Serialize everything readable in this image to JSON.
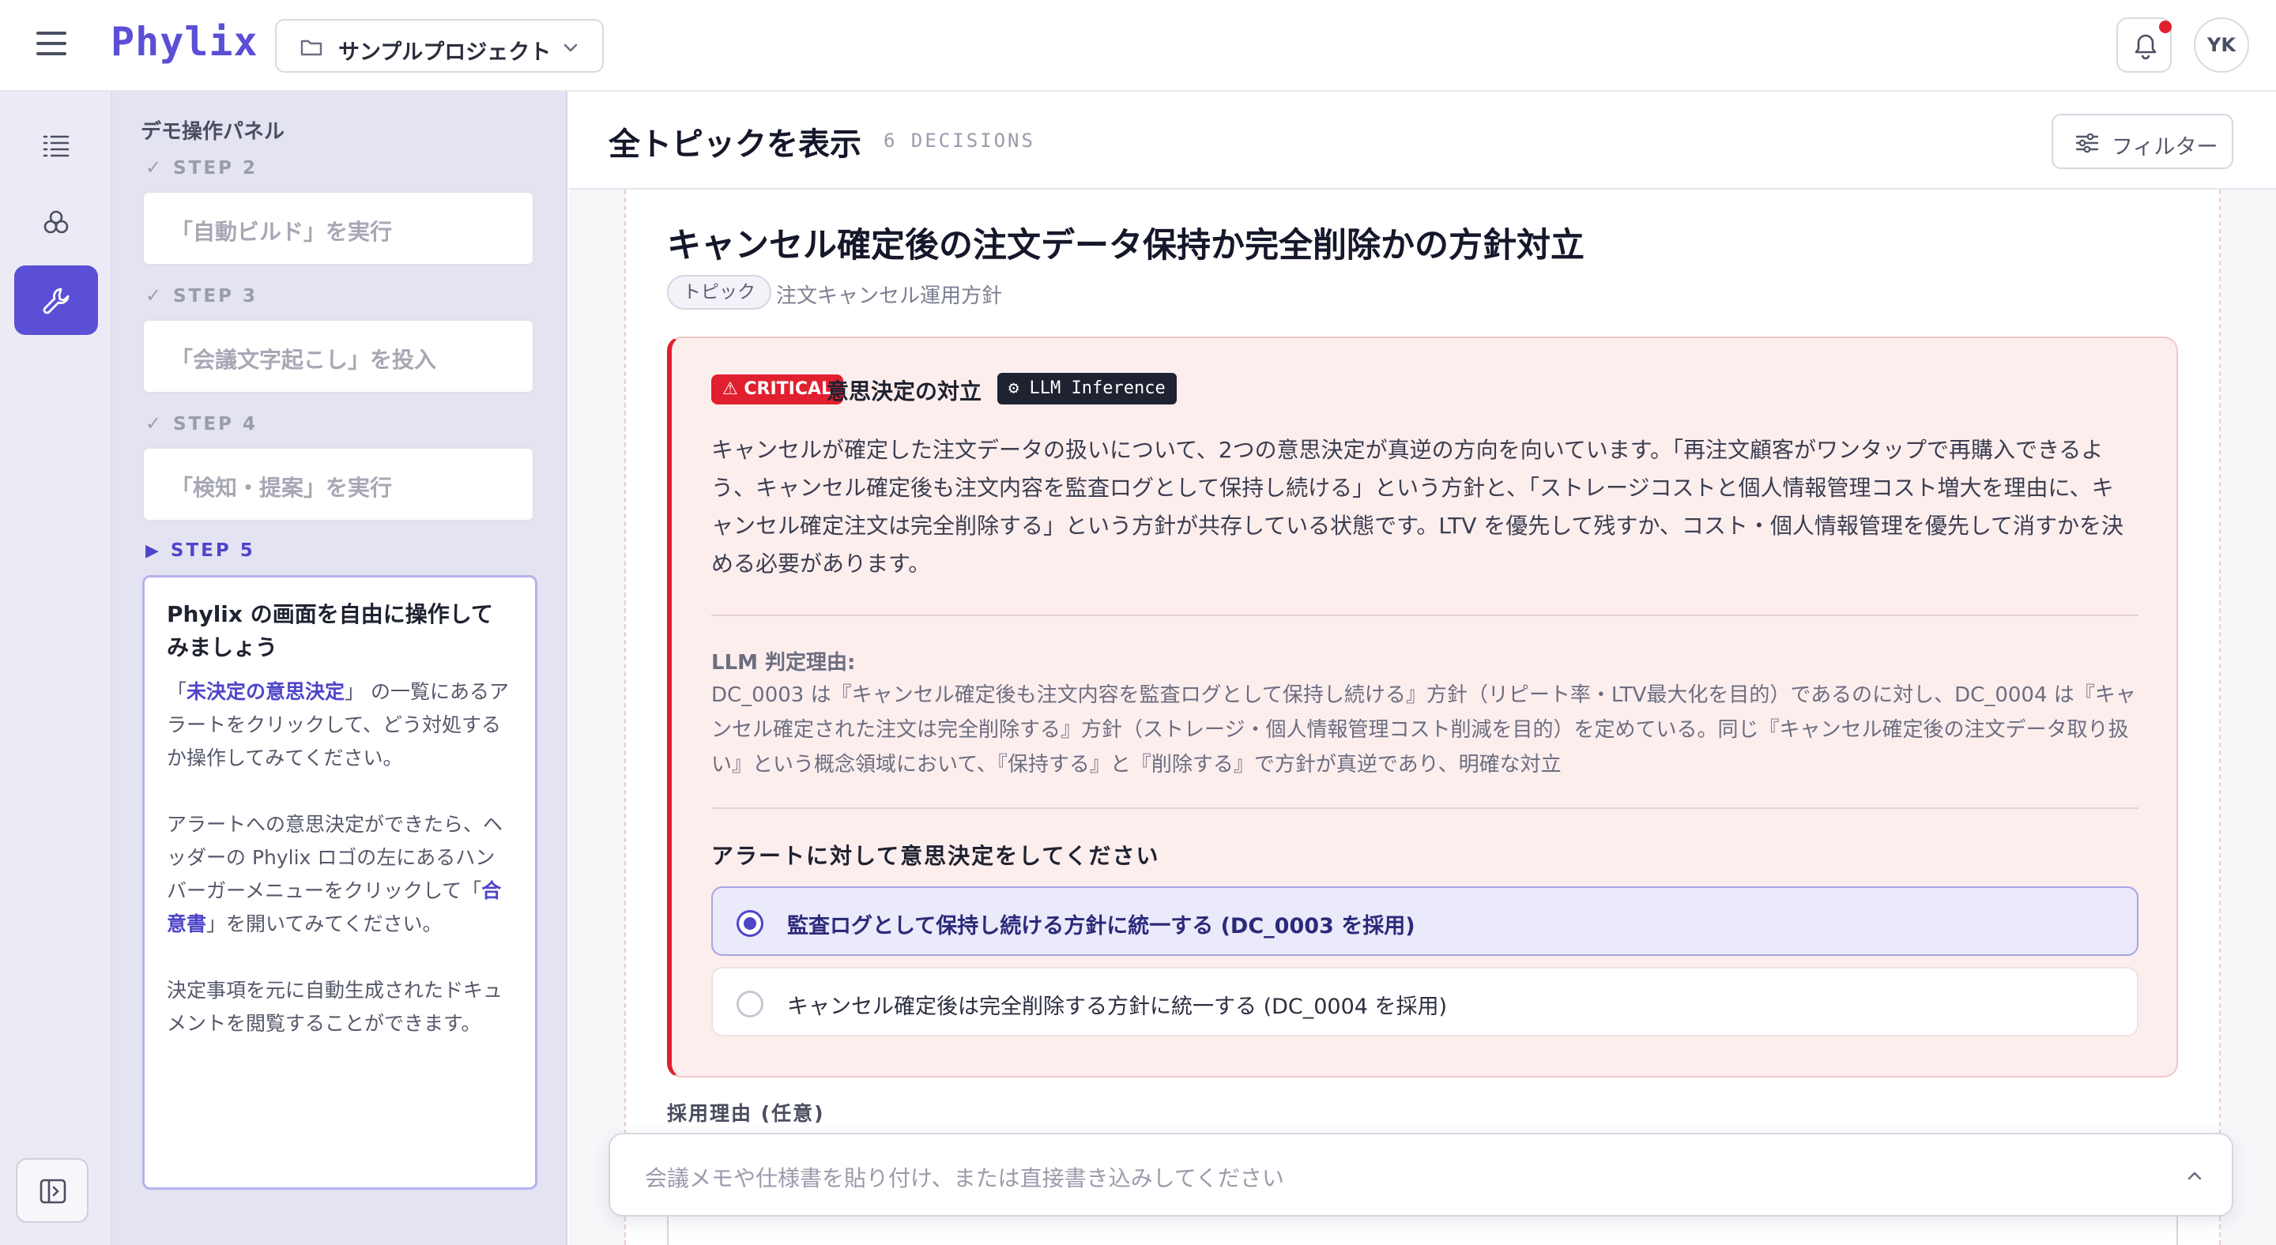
{
  "header": {
    "logo": "Phylix",
    "project_name": "サンプルプロジェクト",
    "avatar_initials": "YK",
    "notification_dot_color": "#e0202f"
  },
  "demo_panel": {
    "title": "デモ操作パネル",
    "steps": [
      {
        "label": "STEP 2",
        "action": "「自動ビルド」を実行",
        "status": "done"
      },
      {
        "label": "STEP 3",
        "action": "「会議文字起こし」を投入",
        "status": "done"
      },
      {
        "label": "STEP 4",
        "action": "「検知・提案」を実行",
        "status": "done"
      }
    ],
    "current_step": {
      "label": "STEP 5",
      "heading": "Phylix の画面を自由に操作してみましょう",
      "p1_pre": "「",
      "p1_link": "未決定の意思決定",
      "p1_post": "」 の一覧にあるアラートをクリックして、どう対処するか操作してみてください。",
      "p2_pre": "アラートへの意思決定ができたら、ヘッダーの Phylix ロゴの左にあるハンバーガーメニューをクリックして「",
      "p2_link": "合意書",
      "p2_post": "」を開いてみてください。",
      "p3": "決定事項を元に自動生成されたドキュメントを閲覧することができます。"
    }
  },
  "main": {
    "title": "全トピックを表示",
    "count_label": "6 DECISIONS",
    "filter_label": "フィルター",
    "decision": {
      "title": "キャンセル確定後の注文データ保持か完全削除かの方針対立",
      "tag": "トピック",
      "topic": "注文キャンセル運用方針",
      "alert": {
        "severity": "CRITICAL",
        "kind": "意思決定の対立",
        "source": "LLM Inference",
        "description": "キャンセルが確定した注文データの扱いについて、2つの意思決定が真逆の方向を向いています。「再注文顧客がワンタップで再購入できるよう、キャンセル確定後も注文内容を監査ログとして保持し続ける」という方針と、「ストレージコストと個人情報管理コスト増大を理由に、キャンセル確定注文は完全削除する」という方針が共存している状態です。LTV を優先して残すか、コスト・個人情報管理を優先して消すかを決める必要があります。",
        "reason_label": "LLM 判定理由:",
        "reason_text": "DC_0003 は『キャンセル確定後も注文内容を監査ログとして保持し続ける』方針（リピート率・LTV最大化を目的）であるのに対し、DC_0004 は『キャンセル確定された注文は完全削除する』方針（ストレージ・個人情報管理コスト削減を目的）を定めている。同じ『キャンセル確定後の注文データ取り扱い』という概念領域において、『保持する』と『削除する』で方針が真逆であり、明確な対立",
        "choice_heading": "アラートに対して意思決定をしてください",
        "options": [
          {
            "label": "監査ログとして保持し続ける方針に統一する (DC_0003 を採用)",
            "selected": true
          },
          {
            "label": "キャンセル確定後は完全削除する方針に統一する (DC_0004 を採用)",
            "selected": false
          }
        ]
      },
      "reason_field_label": "採用理由 (任意)"
    },
    "composer_placeholder": "会議メモや仕様書を貼り付け、または直接書き込みしてください"
  },
  "colors": {
    "brand": "#5b4fd6",
    "critical": "#e0202f",
    "alert_bg": "#fdeeee",
    "selected_option_bg": "#eaeafb"
  }
}
